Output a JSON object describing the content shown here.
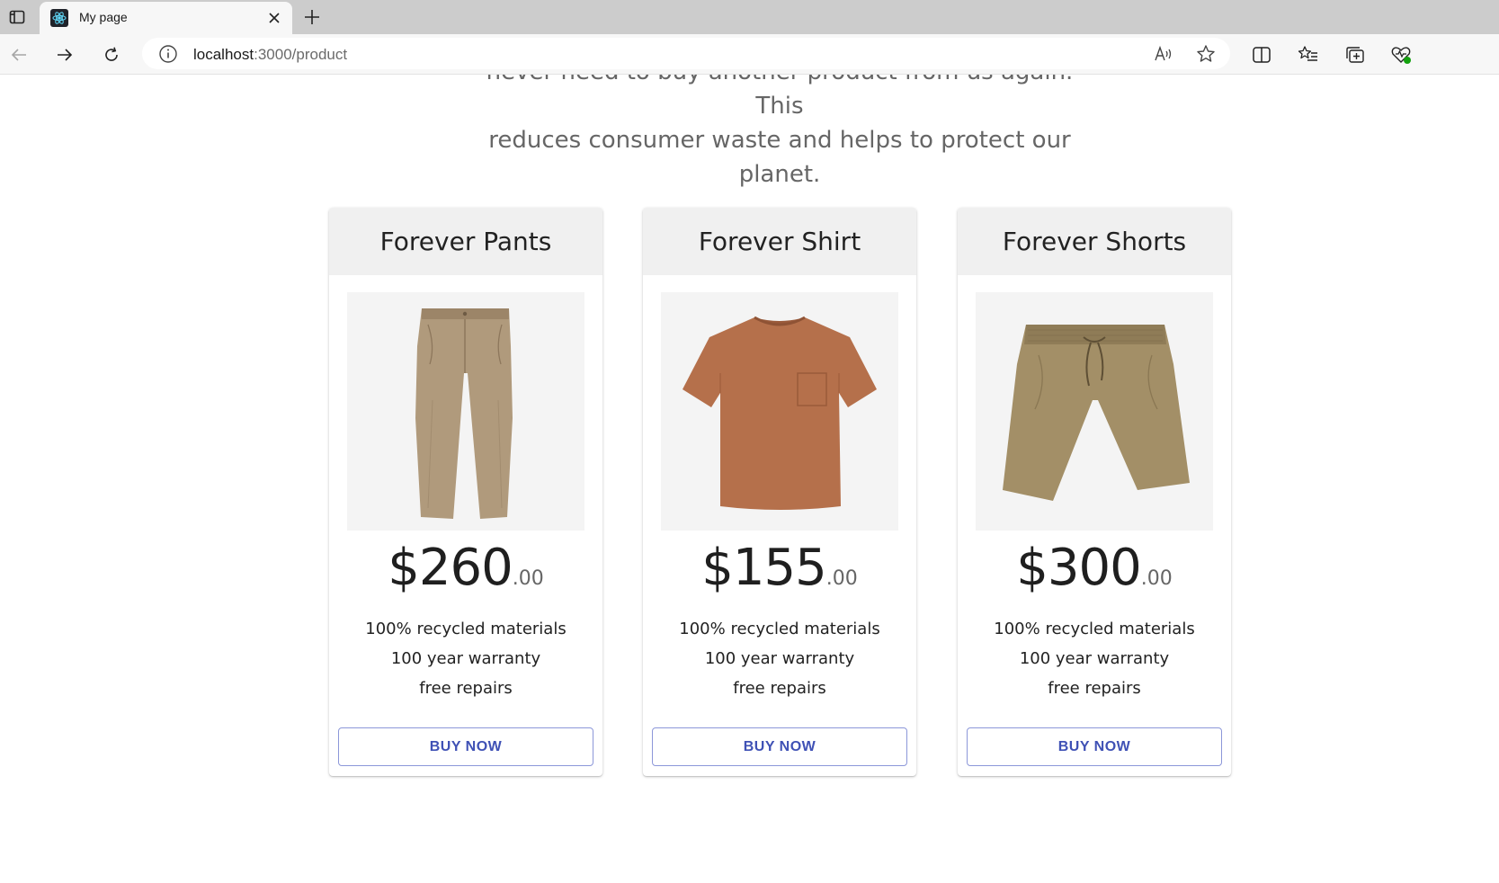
{
  "browser": {
    "tab_title": "My page",
    "url_host": "localhost",
    "url_path": ":3000/product",
    "icons": {
      "tab_actions": "tab-actions-icon",
      "favicon": "react-icon",
      "close": "close-icon",
      "new_tab": "plus-icon",
      "back": "back-arrow-icon",
      "forward": "forward-arrow-icon",
      "refresh": "refresh-icon",
      "info": "info-icon",
      "read_aloud": "read-aloud-icon",
      "favorite": "star-icon",
      "split": "split-screen-icon",
      "favorites": "favorites-list-icon",
      "collections": "collections-icon",
      "health": "browser-essentials-icon"
    }
  },
  "intro": {
    "line1": "never need to buy another product from us again. This",
    "line2": "reduces consumer waste and helps to protect our",
    "line3": "planet."
  },
  "products": [
    {
      "title": "Forever Pants",
      "price_main": "$260",
      "price_cents": ".00",
      "features": [
        "100% recycled materials",
        "100 year warranty",
        "free repairs"
      ],
      "button": "BUY NOW",
      "color": "#b09a7c"
    },
    {
      "title": "Forever Shirt",
      "price_main": "$155",
      "price_cents": ".00",
      "features": [
        "100% recycled materials",
        "100 year warranty",
        "free repairs"
      ],
      "button": "BUY NOW",
      "color": "#b5704b"
    },
    {
      "title": "Forever Shorts",
      "price_main": "$300",
      "price_cents": ".00",
      "features": [
        "100% recycled materials",
        "100 year warranty",
        "free repairs"
      ],
      "button": "BUY NOW",
      "color": "#a38f67"
    }
  ],
  "colors": {
    "accent": "#3f51b5",
    "header_bg": "#f0f0f0"
  }
}
